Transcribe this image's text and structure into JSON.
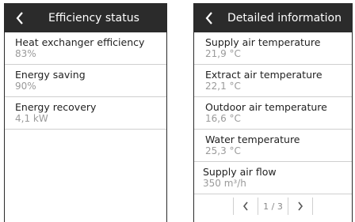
{
  "efficiency": {
    "title": "Efficiency status",
    "items": [
      {
        "label": "Heat exchanger efficiency",
        "value": "83%"
      },
      {
        "label": "Energy saving",
        "value": "90%"
      },
      {
        "label": "Energy recovery",
        "value": "4,1 kW"
      }
    ]
  },
  "detailed": {
    "title": "Detailed information",
    "items": [
      {
        "label": "Supply air temperature",
        "value": "21,9 °C"
      },
      {
        "label": "Extract air temperature",
        "value": "22,1 °C"
      },
      {
        "label": "Outdoor air temperature",
        "value": "16,6 °C"
      },
      {
        "label": "Water temperature",
        "value": "25,3 °C"
      },
      {
        "label": "Supply air flow",
        "value": "350 m³/h"
      }
    ],
    "pager": {
      "text": "1 / 3"
    }
  },
  "icons": {
    "back": "chevron-left-icon",
    "prev": "chevron-left-icon",
    "next": "chevron-right-icon"
  }
}
